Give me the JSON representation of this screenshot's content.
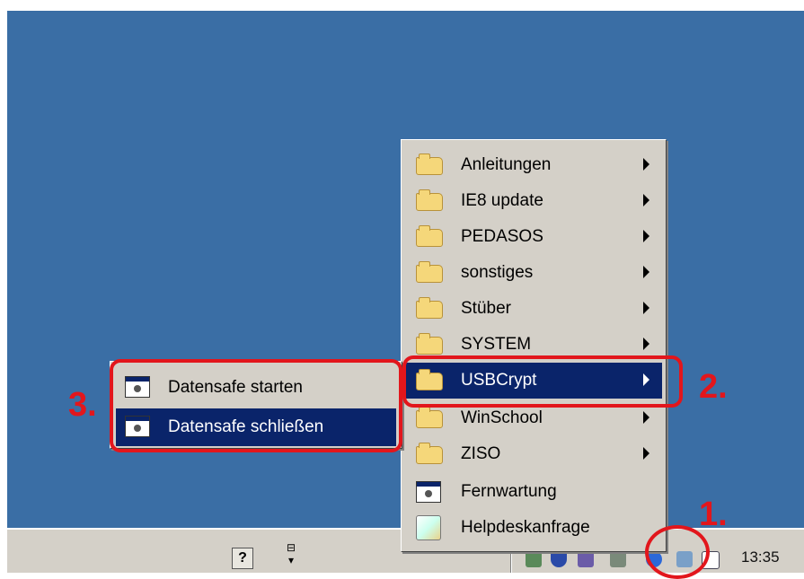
{
  "main_menu": {
    "items": [
      {
        "label": "Anleitungen",
        "icon": "folder-icon",
        "submenu": true
      },
      {
        "label": "IE8 update",
        "icon": "folder-icon",
        "submenu": true
      },
      {
        "label": "PEDASOS",
        "icon": "folder-icon",
        "submenu": true
      },
      {
        "label": "sonstiges",
        "icon": "folder-icon",
        "submenu": true
      },
      {
        "label": "Stüber",
        "icon": "folder-icon",
        "submenu": true
      },
      {
        "label": "SYSTEM",
        "icon": "folder-icon",
        "submenu": true
      },
      {
        "label": "USBCrypt",
        "icon": "folder-icon",
        "submenu": true,
        "selected": true
      },
      {
        "label": "WinSchool",
        "icon": "folder-icon",
        "submenu": true
      },
      {
        "label": "ZISO",
        "icon": "folder-icon",
        "submenu": true
      },
      {
        "label": "Fernwartung",
        "icon": "app-window-icon",
        "submenu": false
      },
      {
        "label": "Helpdeskanfrage",
        "icon": "helpdesk-icon",
        "submenu": false
      }
    ]
  },
  "sub_menu": {
    "items": [
      {
        "label": "Datensafe starten",
        "icon": "app-window-icon"
      },
      {
        "label": "Datensafe schließen",
        "icon": "app-window-icon",
        "selected": true
      }
    ]
  },
  "taskbar": {
    "clock": "13:35",
    "help_icon_glyph": "?"
  },
  "annotations": {
    "step1": "1.",
    "step2": "2.",
    "step3": "3."
  },
  "colors": {
    "desktop": "#3a6ea5",
    "selection": "#0a246a",
    "annotation_red": "#e2161c",
    "menu_bg": "#d4d0c8"
  }
}
